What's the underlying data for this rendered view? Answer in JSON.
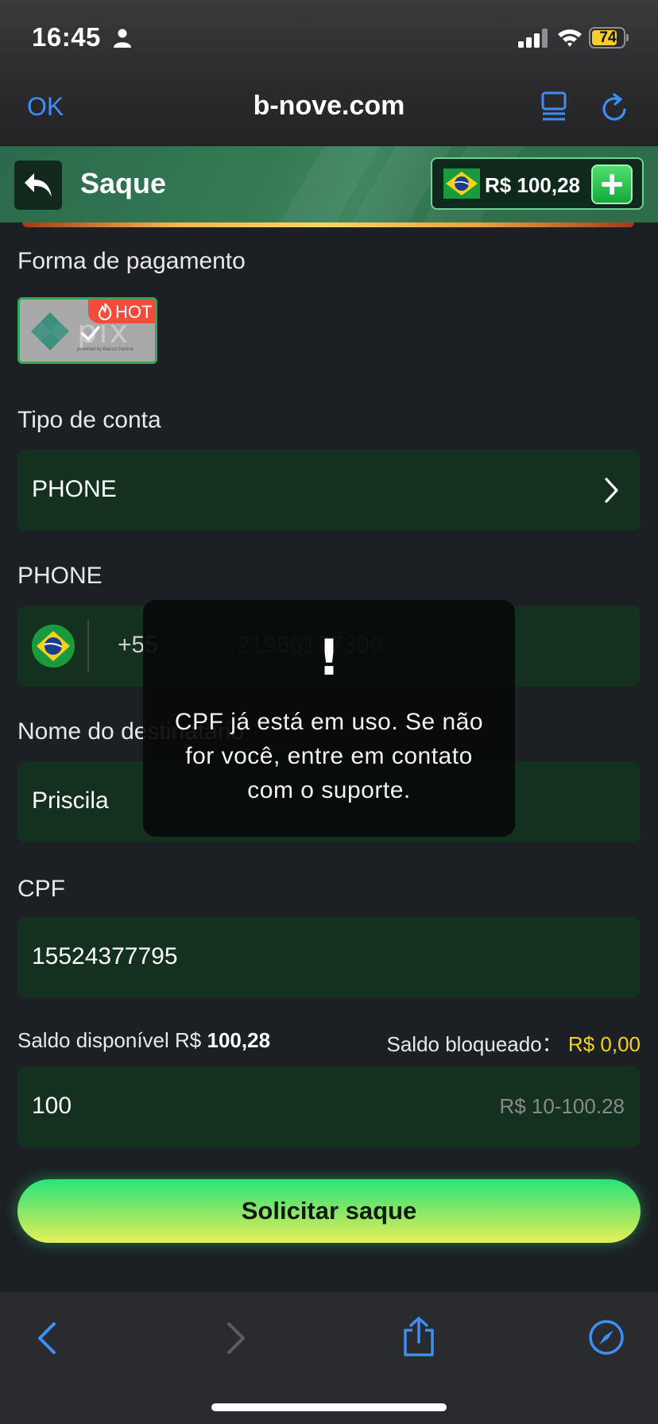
{
  "status_bar": {
    "time": "16:45",
    "battery": "74"
  },
  "browser": {
    "ok_label": "OK",
    "url": "b-nove.com"
  },
  "header": {
    "title": "Saque",
    "balance": "R$ 100,28"
  },
  "payment": {
    "label": "Forma de pagamento",
    "method_word": "pix",
    "method_sub": "powered by Banco Central",
    "badge": "HOT"
  },
  "account_type": {
    "label": "Tipo de conta",
    "value": "PHONE"
  },
  "phone": {
    "label": "PHONE",
    "country_code": "+55",
    "number": "21966177306"
  },
  "recipient": {
    "label": "Nome do destinatário",
    "value": "Priscila"
  },
  "cpf": {
    "label": "CPF",
    "value": "15524377795"
  },
  "saldo": {
    "available_label": "Saldo disponível R$",
    "available_value": "100,28",
    "blocked_label": "Saldo bloqueado：",
    "blocked_value": "R$ 0,00"
  },
  "amount": {
    "value": "100",
    "range": "R$ 10-100.28"
  },
  "submit_label": "Solicitar saque",
  "toast": {
    "icon": "!",
    "message": "CPF já está em uso. Se não for você, entre em contato com o suporte."
  },
  "colors": {
    "accent_green": "#2fa85a",
    "field_bg": "#14301f",
    "yellow": "#f6d21a",
    "ios_blue": "#3d8ff5"
  }
}
